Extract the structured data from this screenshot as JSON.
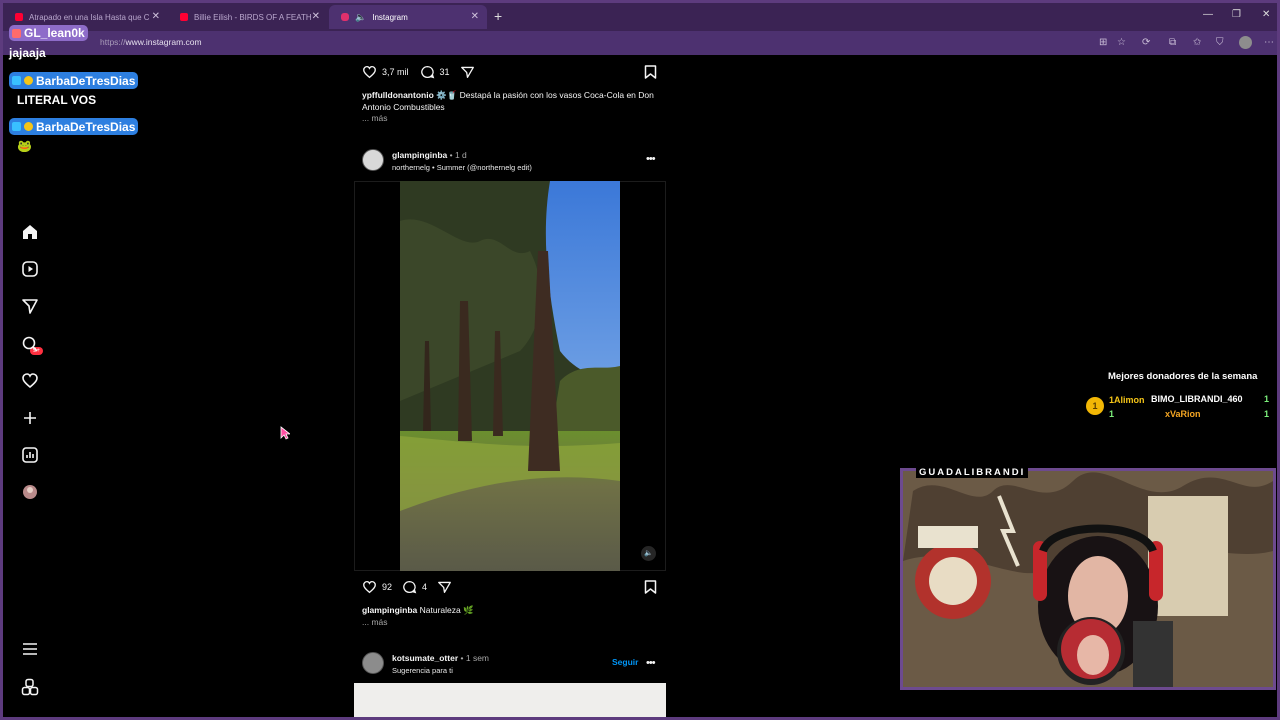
{
  "browser": {
    "tabs": [
      {
        "label": "Atrapado en una Isla Hasta que C",
        "fav_color": "#ff0033"
      },
      {
        "label": "Billie Eilish - BIRDS OF A FEATHER",
        "fav_color": "#ff0033"
      },
      {
        "label": "Instagram",
        "fav_color": "#e1306c"
      }
    ],
    "address_protocol": "https://",
    "address_host": "www.instagram.com"
  },
  "feed": {
    "post1": {
      "likes": "3,7 mil",
      "comments": "31",
      "caption_user": "ypffulldonantonio",
      "caption_text": "⚙️🥤 Destapá la pasión con los vasos Coca-Cola en Don Antonio Combustibles",
      "more": "... más"
    },
    "post2": {
      "username": "glampinginba",
      "time": "• 1 d",
      "audio": "northernelg • Summer (@northernelg edit)",
      "likes": "92",
      "comments": "4",
      "caption_user": "glampinginba",
      "caption_text": "Naturaleza 🌿",
      "more": "... más"
    },
    "post3": {
      "username": "kotsumate_otter",
      "time": "• 1 sem",
      "subtitle": "Sugerencia para ti",
      "follow_label": "Seguir"
    }
  },
  "nav": {
    "notifications_badge": "9+"
  },
  "overlay": {
    "chat": [
      {
        "user": "GL_lean0k",
        "message": "jajaaja"
      },
      {
        "user": "BarbaDeTresDias",
        "message": "LITERAL VOS"
      },
      {
        "user": "BarbaDeTresDias",
        "message": "🐸"
      }
    ],
    "donors_title": "Mejores donadores de la semana",
    "donor_first": "1Alimon",
    "donor_first_amount": "1",
    "donor_second": "BIMO_LIBRANDI_460",
    "donor_second_amount": "1",
    "donor_third": "xVaRion",
    "donor_third_amount": "1",
    "camera_label": "GUADALIBRANDI",
    "colors": {
      "accent": "#6d4a8f",
      "chat_pill": "#2d7fe0",
      "instagram_link": "#0095f6"
    }
  }
}
